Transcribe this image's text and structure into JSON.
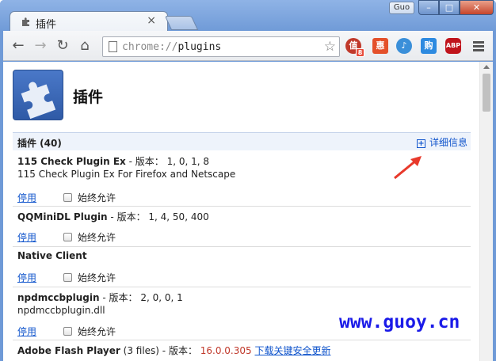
{
  "window": {
    "user_label": "Guo",
    "tab_title": "插件",
    "tab_close": "×",
    "min_label": "–",
    "max_label": "□",
    "close_label": "✕"
  },
  "toolbar": {
    "back": "←",
    "forward": "→",
    "reload": "↻",
    "home": "⌂",
    "url_scheme": "chrome://",
    "url_host": "plugins",
    "star": "☆",
    "extensions": [
      {
        "name": "ext-taobao-icon",
        "label": "值",
        "badge": "8",
        "color": "#c0392b"
      },
      {
        "name": "ext-huiyuan-icon",
        "label": "惠",
        "color": "#e4502a"
      },
      {
        "name": "ext-bird-icon",
        "label": "♪",
        "color": "#3a8fd9"
      },
      {
        "name": "ext-shopping-icon",
        "label": "购",
        "color": "#2d8ae0"
      },
      {
        "name": "ext-adblock-icon",
        "label": "ABP",
        "color": "#c0141c"
      }
    ]
  },
  "page": {
    "title": "插件",
    "section_title": "插件 (40)",
    "details_plus": "+",
    "details_label": "详细信息"
  },
  "plugins": [
    {
      "name": "115 Check Plugin Ex",
      "version_sep": " - 版本： ",
      "version": "1, 0, 1, 8",
      "desc": "115 Check Plugin Ex For Firefox and Netscape",
      "disable": "停用",
      "allow": "始终允许"
    },
    {
      "name": "QQMiniDL Plugin",
      "version_sep": " - 版本： ",
      "version": "1, 4, 50, 400",
      "disable": "停用",
      "allow": "始终允许"
    },
    {
      "name": "Native Client",
      "disable": "停用",
      "allow": "始终允许"
    },
    {
      "name": "npdmccbplugin",
      "version_sep": " - 版本： ",
      "version": "2, 0, 0, 1",
      "desc": "npdmccbplugin.dll",
      "disable": "停用",
      "allow": "始终允许"
    },
    {
      "name": "Adobe Flash Player",
      "files": " (3 files)",
      "version_sep": " - 版本： ",
      "version": "16.0.0.305",
      "update_link": "下载关键安全更新"
    }
  ],
  "watermark": "www.guoy.cn",
  "colors": {
    "link": "#1155cc",
    "warning": "#c0392b",
    "watermark": "#1a1ae8",
    "arrow": "#e8392b"
  }
}
